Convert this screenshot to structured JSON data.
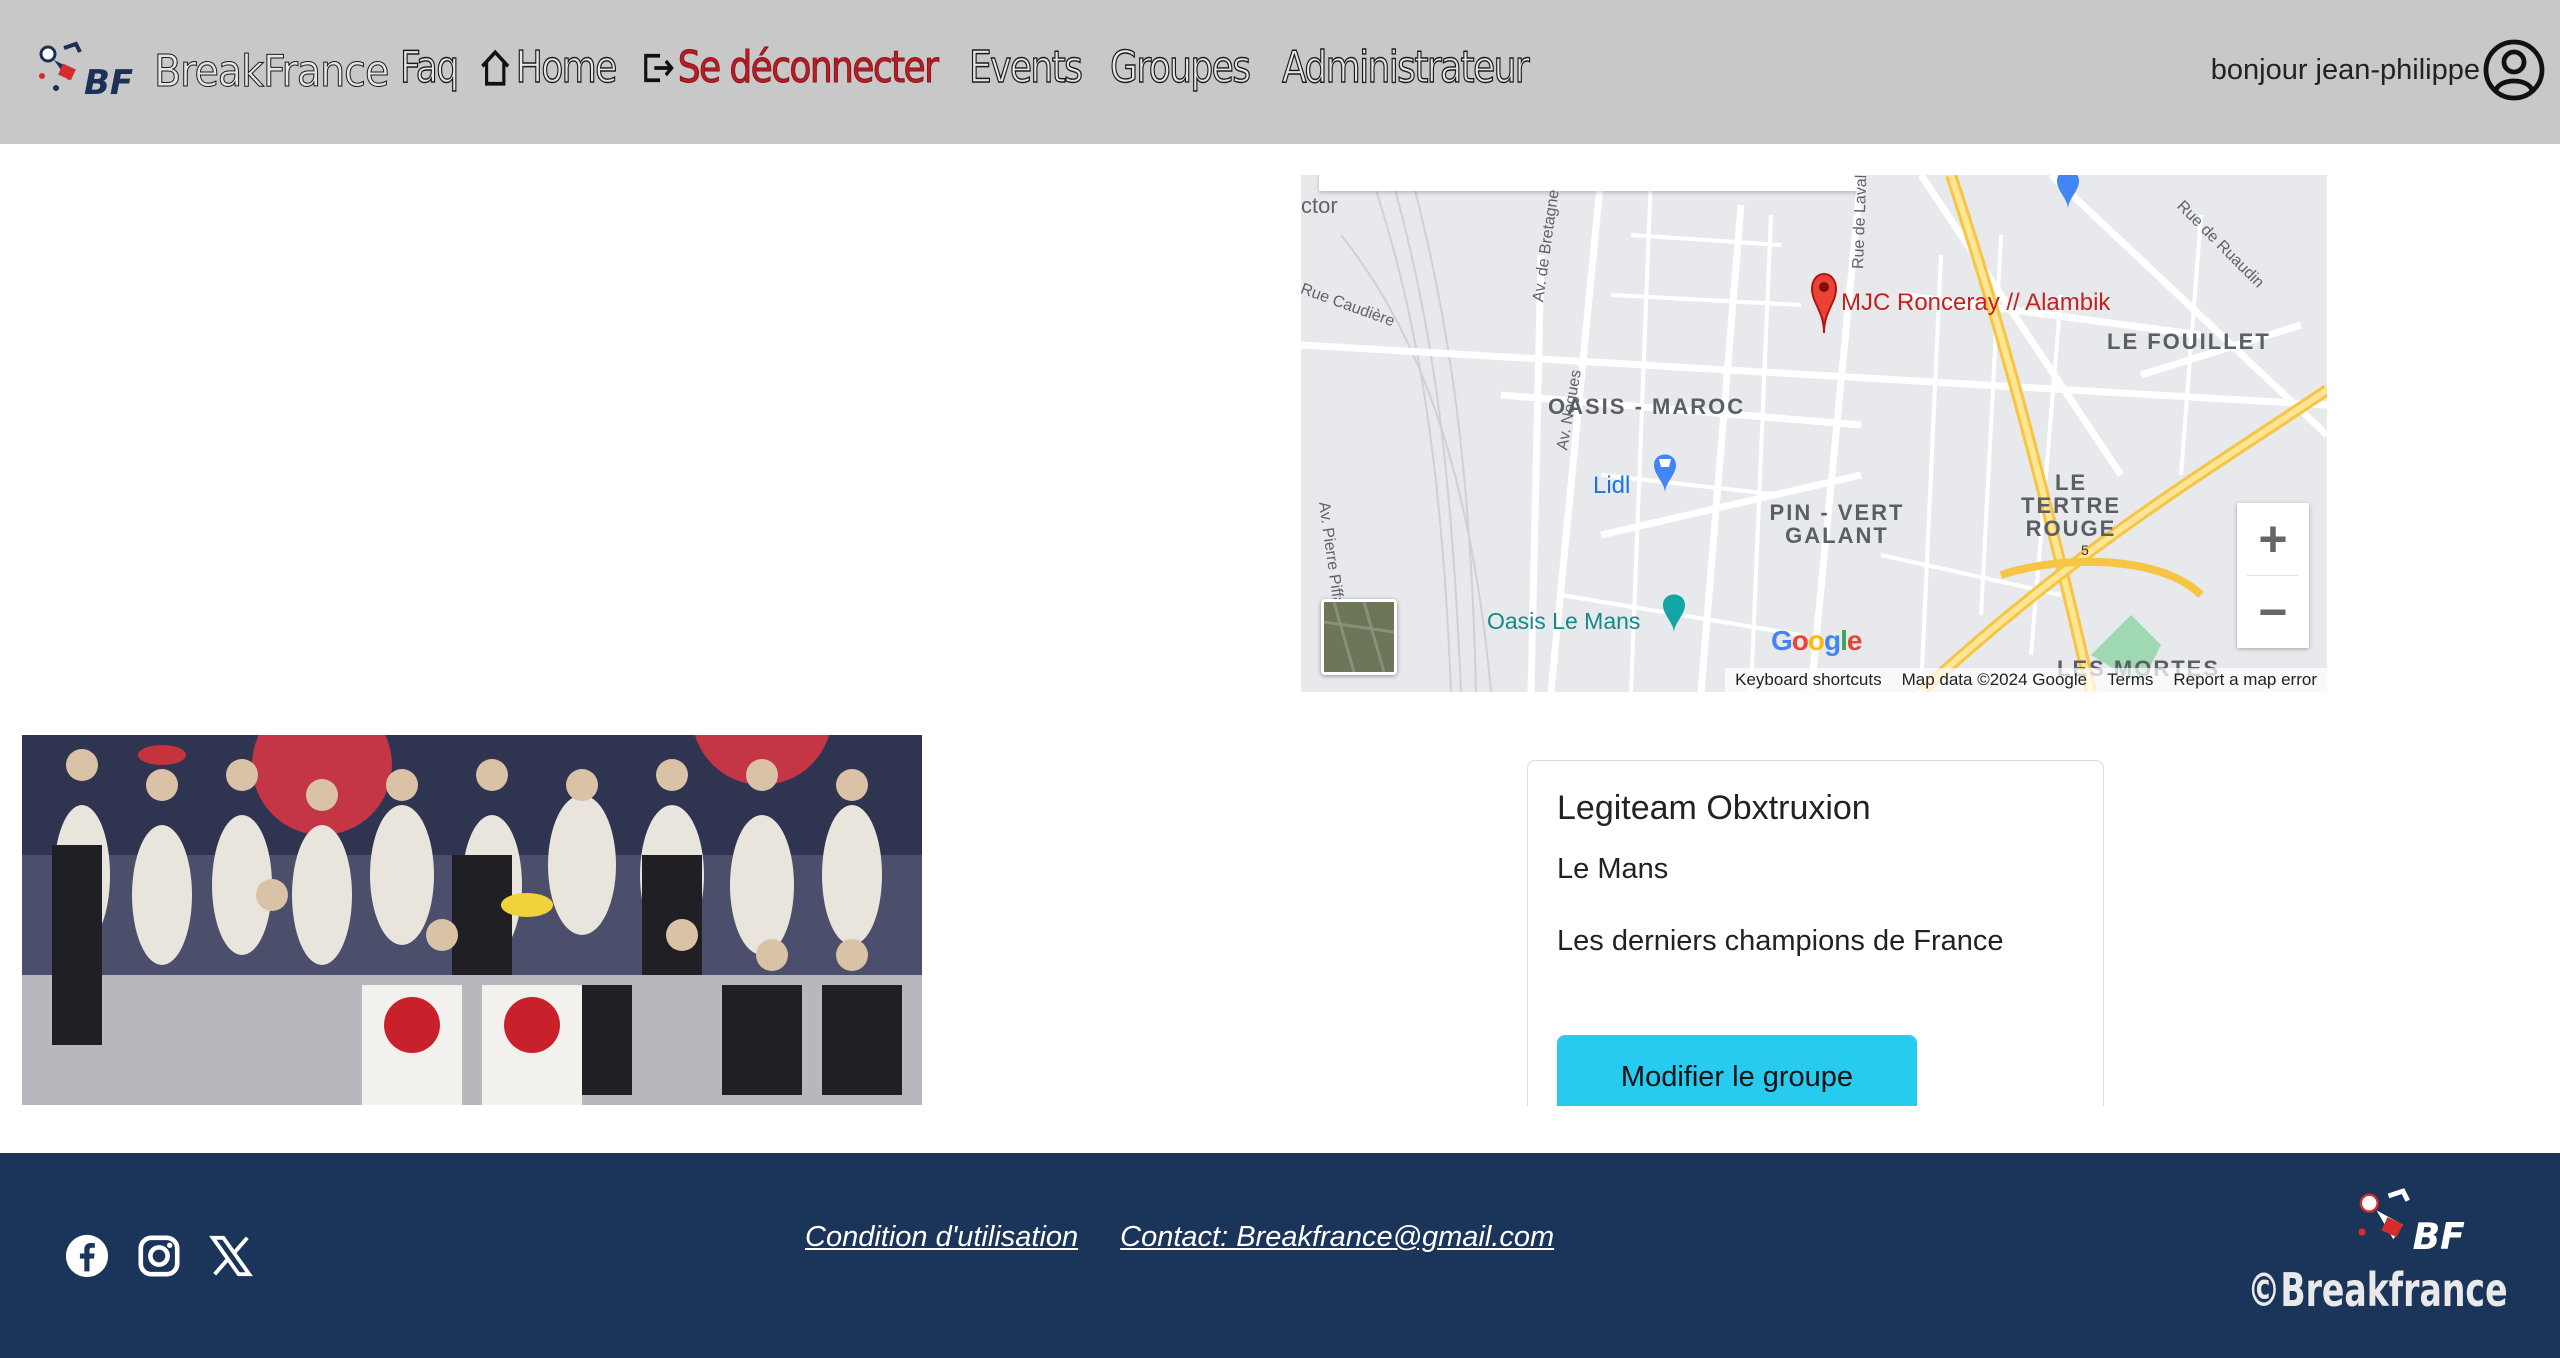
{
  "navbar": {
    "brand": "BreakFrance",
    "links": {
      "faq": "Faq",
      "home": "Home",
      "logout": "Se déconnecter",
      "events": "Events",
      "groups": "Groupes",
      "admin": "Administrateur"
    },
    "greeting": "bonjour jean-philippe"
  },
  "map": {
    "place_label": "MJC Ronceray // Alambik",
    "areas": [
      "LE FOUILLET",
      "OASIS - MAROC",
      "PIN - VERT GALANT",
      "LE TERTRE ROUGE",
      "LES MORTES"
    ],
    "streets": [
      "Rue de Ruaudin",
      "Av. de Bretagne",
      "Av. Nogues",
      "Av. Pierre Piffault",
      "Rue de Laval",
      "ctor",
      "Rue Caudière"
    ],
    "pois": {
      "lidl": "Lidl",
      "oasis": "Oasis Le Mans"
    },
    "road_number": "5",
    "zoom_in": "+",
    "zoom_out": "−",
    "google": "Google",
    "footer": {
      "shortcuts": "Keyboard shortcuts",
      "map_data": "Map data ©2024 Google",
      "terms": "Terms",
      "report": "Report a map error"
    }
  },
  "group": {
    "name": "Legiteam Obxtruxion",
    "city": "Le Mans",
    "description": "Les derniers champions de France",
    "edit_button": "Modifier le groupe"
  },
  "footer": {
    "terms_link": "Condition d'utilisation",
    "contact_link": "Contact: Breakfrance@gmail.com",
    "copyright": "©Breakfrance",
    "social": [
      "facebook-icon",
      "instagram-icon",
      "x-icon"
    ]
  }
}
